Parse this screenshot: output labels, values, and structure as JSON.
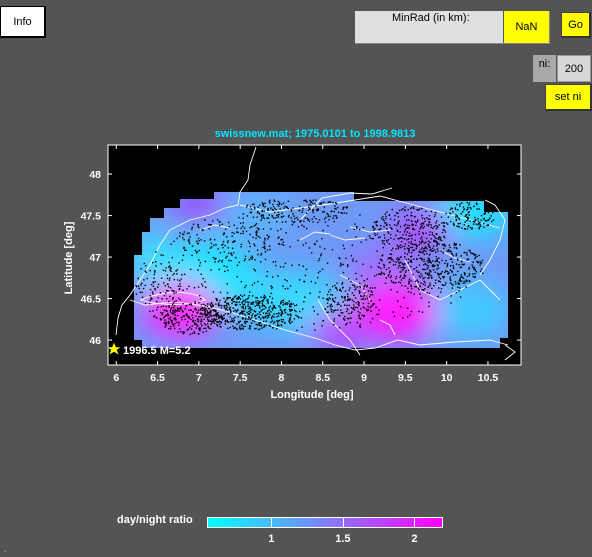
{
  "controls": {
    "info_label": "Info",
    "minrad_label": "MinRad (in km):",
    "minrad_value": "NaN",
    "go_label": "Go",
    "ni_label": "ni:",
    "ni_value": "200",
    "set_ni_label": "set ni"
  },
  "colors": {
    "background": "#545454",
    "button_yellow": "#ffff00",
    "title_cyan": "#00e5ff",
    "map_black": "#000000",
    "cmap_low": "#00ffff",
    "cmap_mid": "#8080ff",
    "cmap_high": "#ff00ff"
  },
  "chart_data": {
    "type": "heatmap",
    "title": "swissnew.mat;  1975.0101 to 1998.9813",
    "xlabel": "Longitude [deg]",
    "ylabel": "Latitude [deg]",
    "xlim": [
      5.9,
      10.9
    ],
    "ylim": [
      45.7,
      48.35
    ],
    "x_ticks": [
      "6",
      "6.5",
      "7",
      "7.5",
      "8",
      "8.5",
      "9",
      "9.5",
      "10",
      "10.5"
    ],
    "y_ticks": [
      "48",
      "47.5",
      "47",
      "46.5",
      "46"
    ],
    "annotation": "1996.5 M=5.2",
    "colorbar": {
      "label": "day/night ratio",
      "range": [
        0.55,
        2.2
      ],
      "ticks": [
        "1",
        "1.5",
        "2"
      ]
    }
  }
}
